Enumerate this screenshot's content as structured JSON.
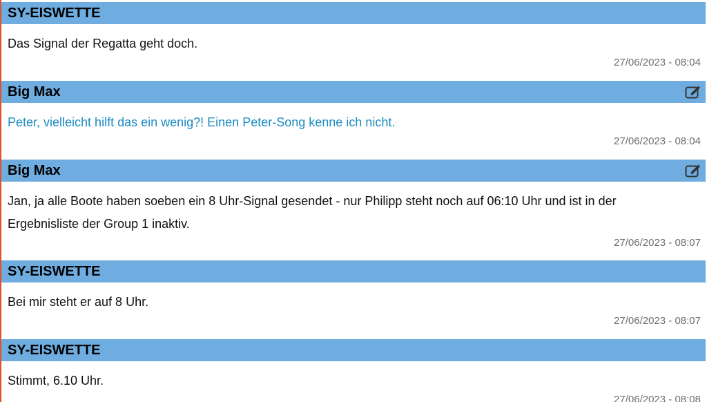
{
  "posts": [
    {
      "author": "SY-EISWETTE",
      "message": "Das Signal der Regatta geht doch.",
      "timestamp": "27/06/2023 - 08:04",
      "own": false
    },
    {
      "author": "Big Max",
      "message": "Peter, vielleicht hilft das ein wenig?! Einen Peter-Song kenne ich nicht.",
      "timestamp": "27/06/2023 - 08:04",
      "own": true,
      "edit_icon": "edit-icon"
    },
    {
      "author": "Big Max",
      "message": "Jan, ja alle Boote haben soeben ein 8 Uhr-Signal gesendet - nur Philipp steht noch auf 06:10 Uhr und ist in der Ergebnisliste der Group 1 inaktiv.",
      "timestamp": "27/06/2023 - 08:07",
      "own": false,
      "edit_icon": "edit-icon"
    },
    {
      "author": "SY-EISWETTE",
      "message": "Bei mir steht er auf 8 Uhr.",
      "timestamp": "27/06/2023 - 08:07",
      "own": false
    },
    {
      "author": "SY-EISWETTE",
      "message": "Stimmt, 6.10 Uhr.",
      "timestamp": "27/06/2023 - 08:08",
      "own": false
    }
  ],
  "colors": {
    "header_bg": "#6fade0",
    "own_message": "#1c8cc0",
    "timestamp": "#6d6d6d",
    "left_rule": "#e0512a"
  }
}
